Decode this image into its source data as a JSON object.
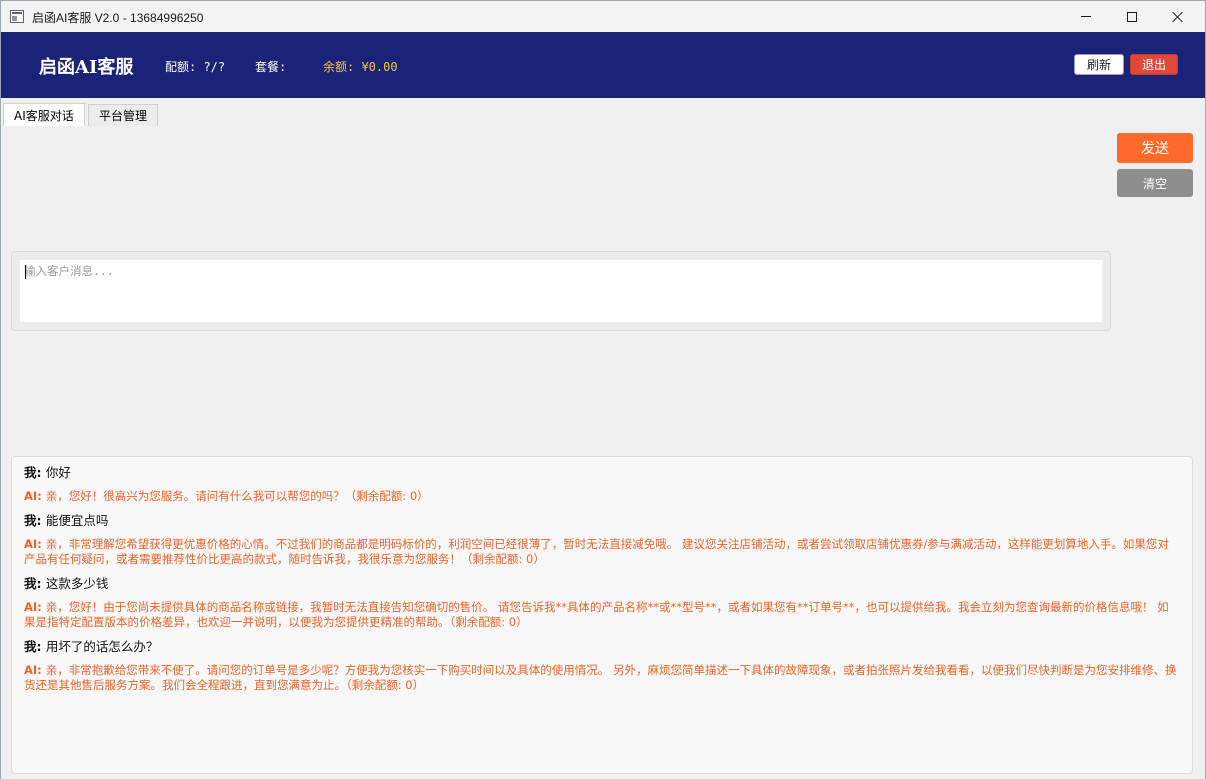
{
  "window": {
    "title": "启函AI客服 V2.0 - 13684996250"
  },
  "header": {
    "brand": "启函AI客服",
    "quota": "配额: ?/?",
    "plan": "套餐:",
    "balance": "余额: ¥0.00",
    "refresh_label": "刷新",
    "logout_label": "退出"
  },
  "tabs": [
    {
      "label": "AI客服对话",
      "active": true
    },
    {
      "label": "平台管理",
      "active": false
    }
  ],
  "actions": {
    "send_label": "发送",
    "clear_label": "清空"
  },
  "input": {
    "placeholder": "输入客户消息...",
    "value": ""
  },
  "chat": {
    "user_prefix": "我",
    "ai_prefix": "AI",
    "messages": [
      {
        "role": "user",
        "text": "你好"
      },
      {
        "role": "ai",
        "text": "亲，您好！很高兴为您服务。请问有什么我可以帮您的吗？（剩余配额: 0）"
      },
      {
        "role": "user",
        "text": "能便宜点吗"
      },
      {
        "role": "ai",
        "text": "亲，非常理解您希望获得更优惠价格的心情。不过我们的商品都是明码标价的，利润空间已经很薄了，暂时无法直接减免哦。 建议您关注店铺活动，或者尝试领取店铺优惠券/参与满减活动，这样能更划算地入手。如果您对产品有任何疑问，或者需要推荐性价比更高的款式，随时告诉我，我很乐意为您服务！（剩余配额: 0）"
      },
      {
        "role": "user",
        "text": "这款多少钱"
      },
      {
        "role": "ai",
        "text": "亲，您好！由于您尚未提供具体的商品名称或链接，我暂时无法直接告知您确切的售价。 请您告诉我**具体的产品名称**或**型号**，或者如果您有**订单号**，也可以提供给我。我会立刻为您查询最新的价格信息哦！ 如果是指特定配置版本的价格差异，也欢迎一并说明，以便我为您提供更精准的帮助。（剩余配额: 0）"
      },
      {
        "role": "user",
        "text": "用坏了的话怎么办？"
      },
      {
        "role": "ai",
        "text": "亲，非常抱歉给您带来不便了。请问您的订单号是多少呢？方便我为您核实一下购买时间以及具体的使用情况。 另外，麻烦您简单描述一下具体的故障现象，或者拍张照片发给我看看，以便我们尽快判断是为您安排维修、换货还是其他售后服务方案。我们会全程跟进，直到您满意为止。（剩余配额: 0）"
      }
    ]
  }
}
